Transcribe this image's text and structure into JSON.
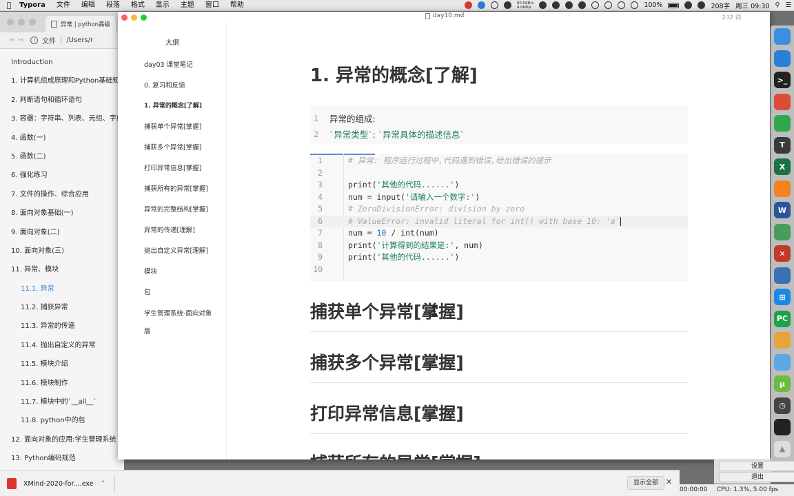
{
  "menubar": {
    "app": "Typora",
    "menus": [
      "文件",
      "编辑",
      "段落",
      "格式",
      "显示",
      "主题",
      "窗口",
      "帮助"
    ],
    "net_up": "60.5KB/s",
    "net_down": "4.0KB/s",
    "battery": "100%",
    "ime": "208字",
    "clock": "周三 09:30"
  },
  "browser": {
    "tab_title": "异常 | python高级",
    "url_label": "文件",
    "url": "/Users/r",
    "toc": [
      {
        "label": "Introduction",
        "level": 1
      },
      {
        "label": "1. 计算机组成原理和Python基础知识",
        "level": 1
      },
      {
        "label": "2. 判断语句和循环语句",
        "level": 1
      },
      {
        "label": "3. 容器：字符串、列表、元组、字典",
        "level": 1
      },
      {
        "label": "4. 函数(一)",
        "level": 1
      },
      {
        "label": "5. 函数(二)",
        "level": 1
      },
      {
        "label": "6. 强化练习",
        "level": 1
      },
      {
        "label": "7. 文件的操作、综合应用",
        "level": 1
      },
      {
        "label": "8. 面向对象基础(一)",
        "level": 1
      },
      {
        "label": "9. 面向对象(二)",
        "level": 1
      },
      {
        "label": "10. 面向对象(三)",
        "level": 1
      },
      {
        "label": "11. 异常、模块",
        "level": 1
      },
      {
        "label": "11.1. 异常",
        "level": 2,
        "active": true
      },
      {
        "label": "11.2. 捕获异常",
        "level": 2
      },
      {
        "label": "11.3. 异常的传递",
        "level": 2
      },
      {
        "label": "11.4. 抛出自定义的异常",
        "level": 2
      },
      {
        "label": "11.5. 模块介绍",
        "level": 2
      },
      {
        "label": "11.6. 模块制作",
        "level": 2
      },
      {
        "label": "11.7. 模块中的`__all__`",
        "level": 2
      },
      {
        "label": "11.8. python中的包",
        "level": 2
      },
      {
        "label": "12. 面向对象的应用:学生管理系统",
        "level": 1
      },
      {
        "label": "13. Python编码规范",
        "level": 1
      }
    ]
  },
  "typora": {
    "doc_title": "day10.md",
    "word_count": "232 词",
    "outline": {
      "title": "大纲",
      "items": [
        {
          "label": "day03 课堂笔记"
        },
        {
          "label": "0. 复习和反馈"
        },
        {
          "label": "1. 异常的概念[了解]",
          "current": true
        },
        {
          "label": "捕获单个异常[掌握]"
        },
        {
          "label": "捕获多个异常[掌握]"
        },
        {
          "label": "打印异常信息[掌握]"
        },
        {
          "label": "捕获所有的异常[掌握]"
        },
        {
          "label": "异常的完整结构[掌握]"
        },
        {
          "label": "异常的传递[理解]"
        },
        {
          "label": "抛出自定义异常[理解]"
        },
        {
          "label": "模块"
        },
        {
          "label": "包"
        },
        {
          "label": "学生管理系统-面向对象"
        },
        {
          "label": "版"
        }
      ]
    },
    "heading1": "1. 异常的概念[了解]",
    "block1": {
      "lines": [
        {
          "n": "1",
          "text": "异常的组成:"
        },
        {
          "n": "2",
          "text": "`异常类型`: `异常具体的描述信息`"
        }
      ]
    },
    "block2": {
      "lines": [
        {
          "n": "1",
          "text": "# 异常: 程序运行过程中,代码遇到错误,给出错误的提示"
        },
        {
          "n": "2",
          "text": ""
        },
        {
          "n": "3",
          "text": "print('其他的代码......')"
        },
        {
          "n": "4",
          "text": "num = input('请输入一个数字:')"
        },
        {
          "n": "5",
          "text": "# ZeroDivisionError: division by zero"
        },
        {
          "n": "6",
          "text": "# ValueError: invalid literal for int() with base 10: 'a'"
        },
        {
          "n": "7",
          "text": "num = 10 / int(num)"
        },
        {
          "n": "8",
          "text": "print('计算得到的结果是:', num)"
        },
        {
          "n": "9",
          "text": "print('其他的代码......')"
        },
        {
          "n": "10",
          "text": ""
        }
      ]
    },
    "heading2s": [
      "捕获单个异常[掌握]",
      "捕获多个异常[掌握]",
      "打印异常信息[掌握]",
      "捕获所有的异常[掌握]"
    ]
  },
  "dock": {
    "icons": [
      "finder-icon",
      "safari-icon",
      "terminal-icon",
      "chrome-icon",
      "evernote-icon",
      "typora-icon",
      "excel-icon",
      "sublime-icon",
      "word-icon",
      "network-icon",
      "xmind-icon",
      "virtualbox-icon",
      "windows-icon",
      "pycharm-icon",
      "sequel-icon",
      "folder-icon",
      "utorrent-icon",
      "clock-icon",
      "obs-icon",
      "trash-icon"
    ]
  },
  "downloads": {
    "file": "XMind-2020-for....exe",
    "show_all": "显示全部"
  },
  "obs": {
    "settings": "设置",
    "exit": "退出",
    "time": "00:00:00",
    "cpu": "CPU: 1.3%, 5.00 fps"
  }
}
